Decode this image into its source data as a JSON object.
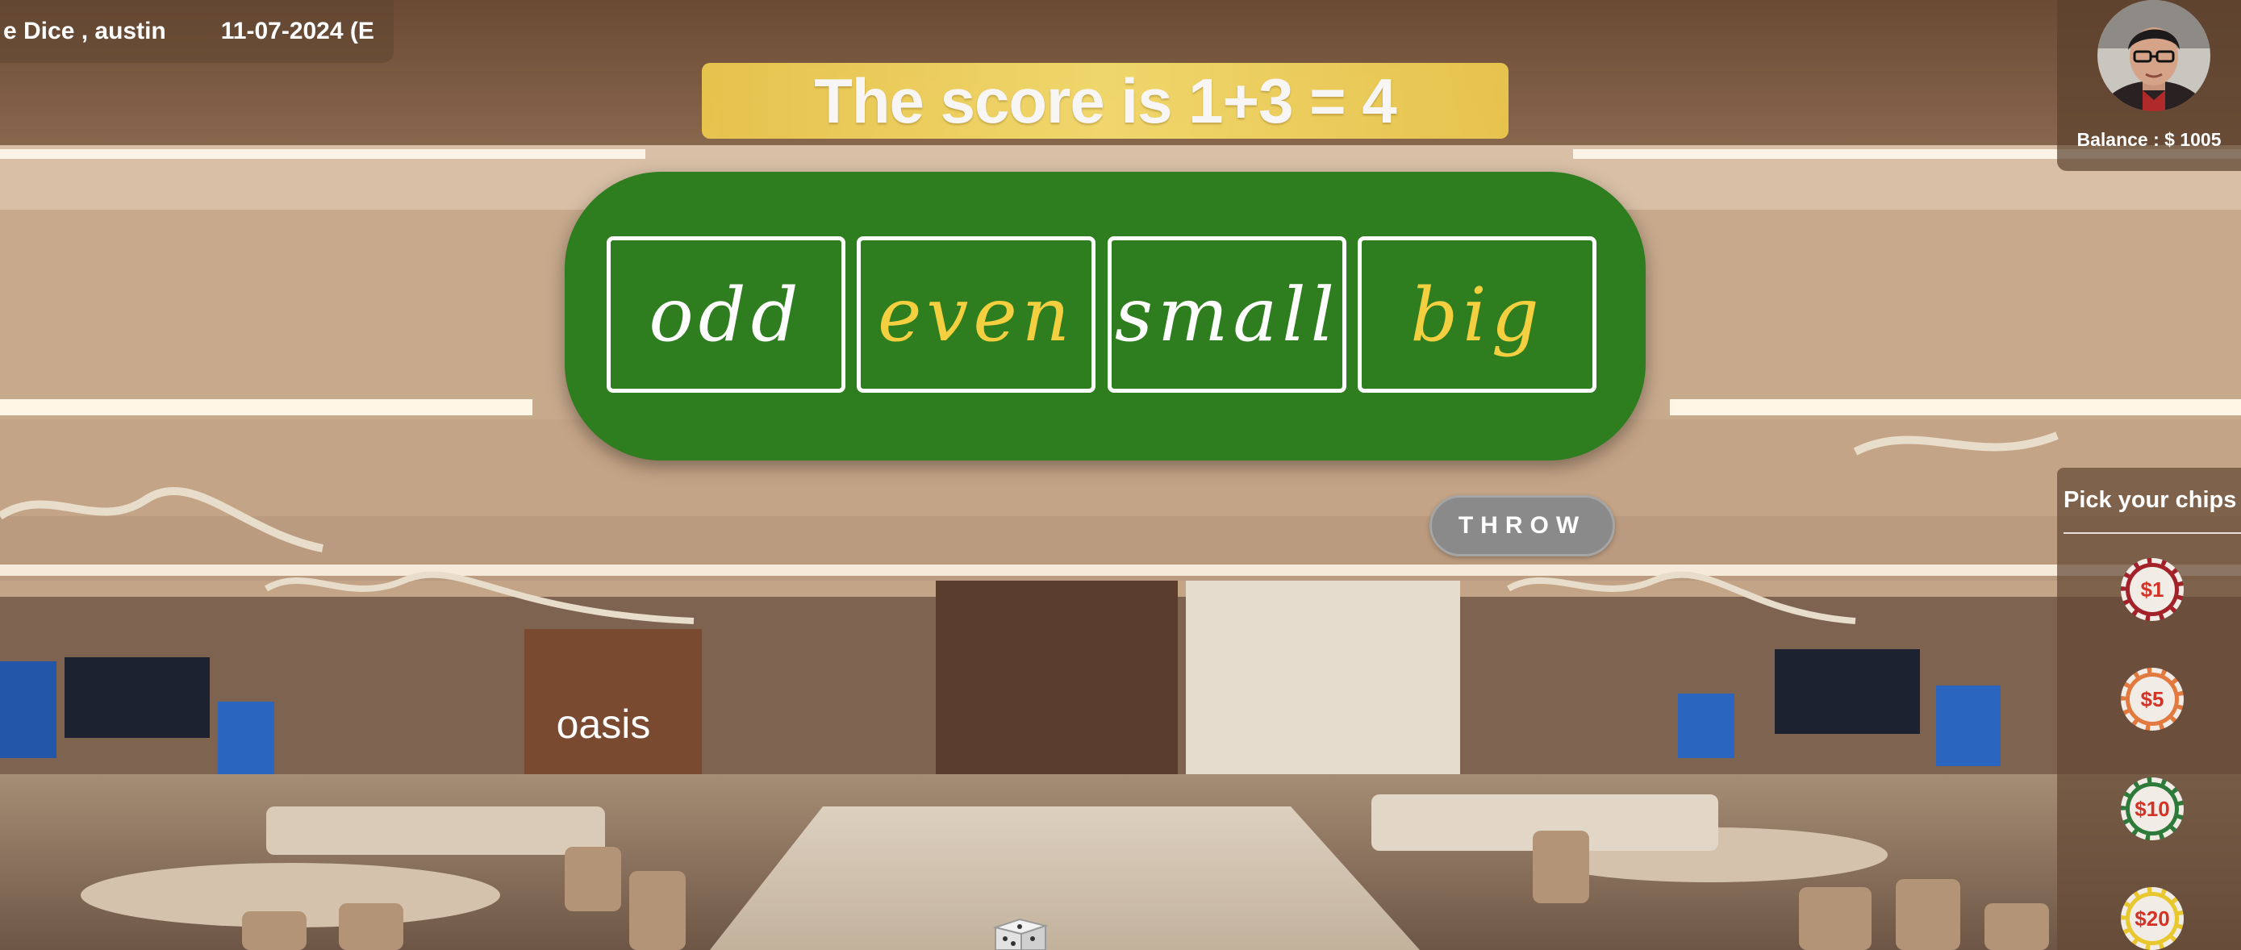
{
  "header": {
    "game_user": "e Dice , austin",
    "date": "11-07-2024 (E"
  },
  "score": {
    "text": "The score is 1+3 = 4"
  },
  "bets": [
    {
      "label": "odd",
      "color": "#ffffff"
    },
    {
      "label": "even",
      "color": "#f4cf40"
    },
    {
      "label": "small",
      "color": "#ffffff"
    },
    {
      "label": "big",
      "color": "#f4cf40"
    }
  ],
  "throw_button": {
    "label": "THROW"
  },
  "player": {
    "balance_text": "Balance : $ 1005"
  },
  "chips": {
    "title": "Pick your chips",
    "items": [
      {
        "label": "$1",
        "ring_color": "#a3222a"
      },
      {
        "label": "$5",
        "ring_color": "#e27a40"
      },
      {
        "label": "$10",
        "ring_color": "#2e7a3a"
      },
      {
        "label": "$20",
        "ring_color": "#e8c82e"
      }
    ]
  },
  "scene": {
    "venue_sign": "oasis"
  },
  "colors": {
    "board_green": "#2e7d1f",
    "banner_gold": "#f0d15a",
    "throw_gray": "#8a8a8a"
  }
}
